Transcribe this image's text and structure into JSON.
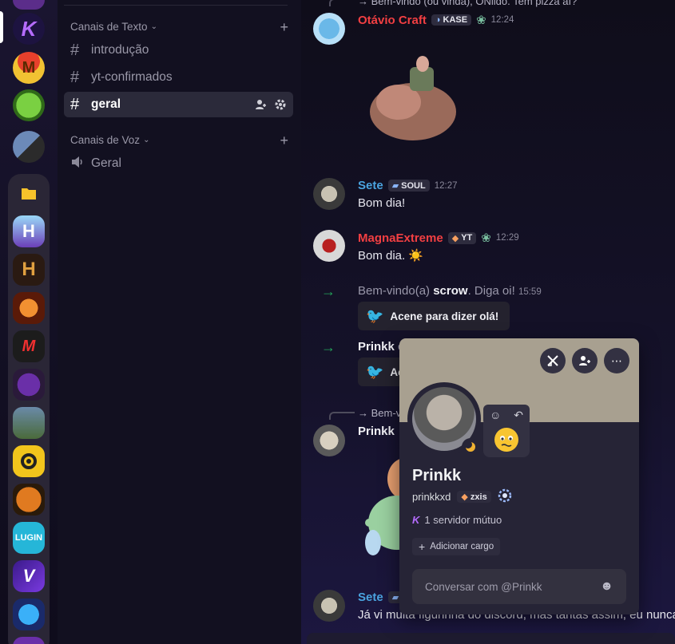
{
  "channels": {
    "text_category": "Canais de Texto",
    "voice_category": "Canais de Voz",
    "text_channels": [
      "introdução",
      "yt-confirmados",
      "geral"
    ],
    "voice_channels": [
      "Geral"
    ]
  },
  "guild_rail": {
    "servers": [
      "K",
      "M",
      "H",
      "H",
      "M",
      "LUGIN"
    ]
  },
  "messages": {
    "top_reply": "→ Bem-vindo (ou vinda), ONildo. Tem pizza aí?",
    "m1": {
      "author": "Otávio Craft",
      "tag": "KASE",
      "time": "12:24"
    },
    "m2": {
      "author": "Sete",
      "tag": "SOUL",
      "time": "12:27",
      "text": "Bom dia!"
    },
    "m3": {
      "author": "MagnaExtreme",
      "tag": "YT",
      "time": "12:29",
      "text": "Bom dia. ☀️"
    },
    "m4": {
      "prefix": "Bem-vindo(a) ",
      "user": "scrow",
      "suffix": ". Diga oi!",
      "time": "15:59",
      "button": "Acene para dizer olá!"
    },
    "m5": {
      "user": "Prinkk",
      "suffix": " c",
      "button": "Ac"
    },
    "m6_reply": "→ Bem-v",
    "m6": {
      "author": "Prinkk"
    },
    "m7": {
      "author": "Sete",
      "text": "Já vi muita figurinha do discord, mas tantas assim, eu nunca"
    }
  },
  "popout": {
    "display_name": "Prinkk",
    "username": "prinkkxd",
    "clan_tag": "zxis",
    "mutual_servers": "1 servidor mútuo",
    "add_role": "Adicionar cargo",
    "message_placeholder": "Conversar com @Prinkk"
  },
  "colors": {
    "red_name": "#f23f42",
    "blue_name": "#4aa3df",
    "green_arrow": "#23a55a",
    "banner": "#a8a090"
  }
}
